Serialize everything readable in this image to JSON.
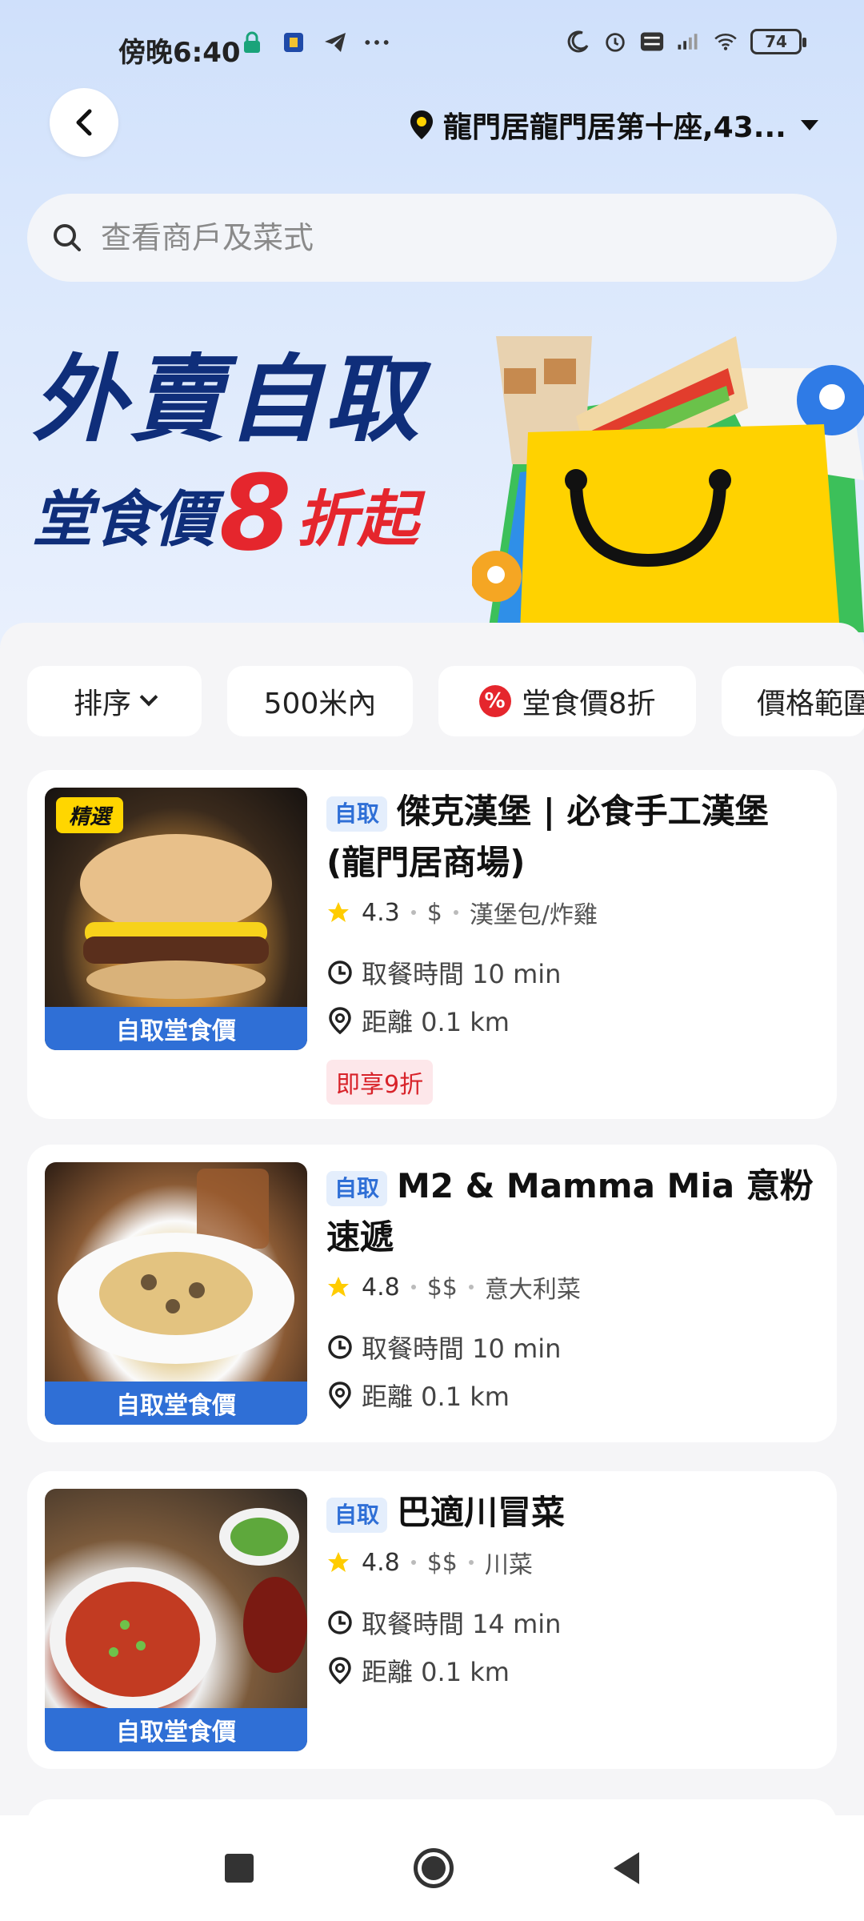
{
  "status_bar": {
    "time": "傍晚6:40",
    "battery": "74"
  },
  "header": {
    "location": "龍門居龍門居第十座,43..."
  },
  "search": {
    "placeholder": "查看商戶及菜式"
  },
  "promo": {
    "line1": "外賣自取",
    "line2_prefix": "堂食價",
    "line2_number": "8",
    "line2_suffix": "折起"
  },
  "filters": [
    {
      "label": "排序"
    },
    {
      "label": "500米內"
    },
    {
      "label": "堂食價8折"
    },
    {
      "label": "價格範圍"
    }
  ],
  "restaurants": [
    {
      "tag": "自取",
      "name": "傑克漢堡 | 必食手工漢堡 (龍門居商場)",
      "rating": "4.3",
      "price": "$",
      "cuisine": "漢堡包/炸雞",
      "pickup_time": "取餐時間 10 min",
      "distance": "距離 0.1 km",
      "image_caption": "自取堂食價",
      "featured_label": "精選",
      "discount": "即享9折"
    },
    {
      "tag": "自取",
      "name": "M2 & Mamma Mia 意粉速遞",
      "rating": "4.8",
      "price": "$$",
      "cuisine": "意大利菜",
      "pickup_time": "取餐時間 10 min",
      "distance": "距離 0.1 km",
      "image_caption": "自取堂食價"
    },
    {
      "tag": "自取",
      "name": "巴適川冒菜",
      "rating": "4.8",
      "price": "$$",
      "cuisine": "川菜",
      "pickup_time": "取餐時間 14 min",
      "distance": "距離 0.1 km",
      "image_caption": "自取堂食價"
    }
  ],
  "colors": {
    "accent_blue": "#2f6fd6",
    "promo_navy": "#0f2e7a",
    "promo_red": "#e5262d"
  },
  "icons": [
    "back-arrow-icon",
    "location-pin-icon",
    "search-icon",
    "star-icon",
    "clock-icon",
    "distance-pin-icon",
    "discount-badge-icon"
  ]
}
